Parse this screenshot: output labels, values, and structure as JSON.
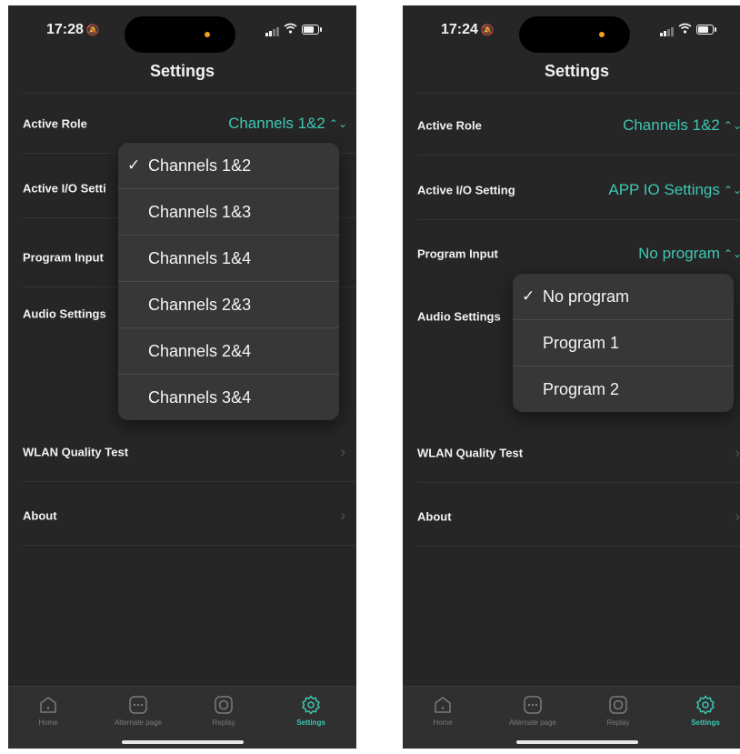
{
  "left": {
    "status": {
      "time": "17:28"
    },
    "title": "Settings",
    "rows": [
      {
        "label": "Active Role",
        "value": "Channels 1&2"
      },
      {
        "label": "Active I/O Setti"
      },
      {
        "label": "Program Input"
      },
      {
        "label": "Audio Settings"
      },
      {
        "label": "WLAN Quality Test"
      },
      {
        "label": "About"
      }
    ],
    "dropdown": {
      "items": [
        "Channels 1&2",
        "Channels 1&3",
        "Channels 1&4",
        "Channels 2&3",
        "Channels 2&4",
        "Channels 3&4"
      ],
      "selected_index": 0
    }
  },
  "right": {
    "status": {
      "time": "17:24"
    },
    "title": "Settings",
    "rows": [
      {
        "label": "Active Role",
        "value": "Channels 1&2"
      },
      {
        "label": "Active I/O Setting",
        "value": "APP IO Settings"
      },
      {
        "label": "Program Input",
        "value": "No program"
      },
      {
        "label": "Audio Settings"
      },
      {
        "label": "WLAN Quality Test"
      },
      {
        "label": "About"
      }
    ],
    "dropdown": {
      "items": [
        "No program",
        "Program  1",
        "Program  2"
      ],
      "selected_index": 0
    }
  },
  "check_glyph": "✓",
  "chevron_glyph": "›",
  "updown_glyph": "⌃⌄",
  "tabs": [
    {
      "label": "Home",
      "icon": "home-icon"
    },
    {
      "label": "Alternate page",
      "icon": "alternate-page-icon"
    },
    {
      "label": "Replay",
      "icon": "replay-icon"
    },
    {
      "label": "Settings",
      "icon": "settings-gear-icon",
      "active": true
    }
  ],
  "colors": {
    "accent": "#3fc6b3",
    "background": "#262626",
    "dropdown_bg": "#373737",
    "tabbar_bg": "#303030"
  }
}
